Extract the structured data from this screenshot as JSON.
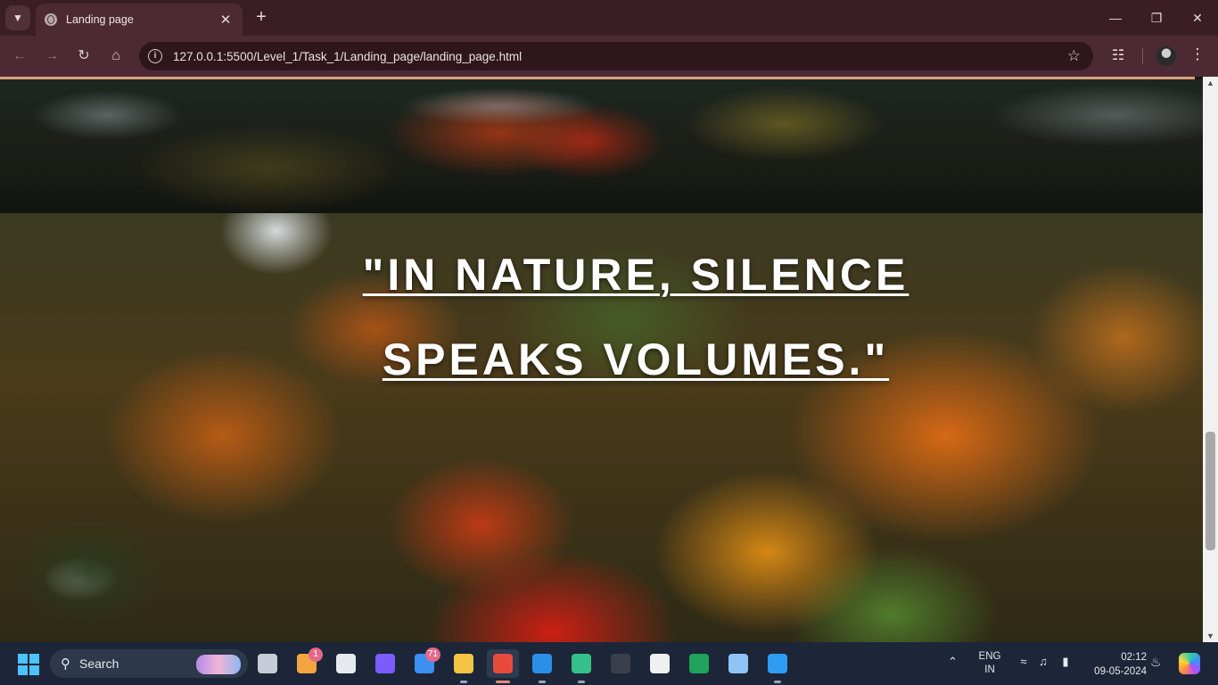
{
  "browser": {
    "tab": {
      "title": "Landing page"
    },
    "address_bar": {
      "url": "127.0.0.1:5500/Level_1/Task_1/Landing_page/landing_page.html"
    },
    "icons": {
      "tab_search": "chevron-down-icon",
      "back": "arrow-left-icon",
      "forward": "arrow-right-icon",
      "reload": "reload-icon",
      "home": "home-icon",
      "site_info": "info-icon",
      "bookmark": "star-icon",
      "extensions": "puzzle-icon",
      "menu": "kebab-icon"
    }
  },
  "page": {
    "accent_color": "#d8a07a",
    "quote": {
      "line1": "\"IN NATURE, SILENCE",
      "line2": "SPEAKS VOLUMES.\""
    }
  },
  "taskbar": {
    "search": {
      "label": "Search"
    },
    "apps": [
      {
        "name": "task-view",
        "color": "#c7cdd6",
        "badge": ""
      },
      {
        "name": "widgets",
        "color": "#f2a541",
        "badge": "1"
      },
      {
        "name": "dell",
        "color": "#e6e9ef",
        "badge": ""
      },
      {
        "name": "copilot-store",
        "color": "#7a5cff",
        "badge": ""
      },
      {
        "name": "mail",
        "color": "#3a8ff0",
        "badge": "71"
      },
      {
        "name": "file-explorer",
        "color": "#f4c542",
        "badge": ""
      },
      {
        "name": "chrome",
        "color": "#e84a3b",
        "badge": "",
        "active": true
      },
      {
        "name": "vscode",
        "color": "#2b8fe8",
        "badge": ""
      },
      {
        "name": "git-kraken",
        "color": "#35c08a",
        "badge": ""
      },
      {
        "name": "terminal",
        "color": "#3a3f4b",
        "badge": ""
      },
      {
        "name": "github",
        "color": "#f0f0f0",
        "badge": ""
      },
      {
        "name": "mongodb-compass",
        "color": "#1fa35c",
        "badge": ""
      },
      {
        "name": "resource-monitor",
        "color": "#8fc3f5",
        "badge": ""
      },
      {
        "name": "photos",
        "color": "#2f9cf3",
        "badge": ""
      }
    ],
    "tray": {
      "language_line1": "ENG",
      "language_line2": "IN",
      "time": "02:12",
      "date": "09-05-2024"
    }
  }
}
